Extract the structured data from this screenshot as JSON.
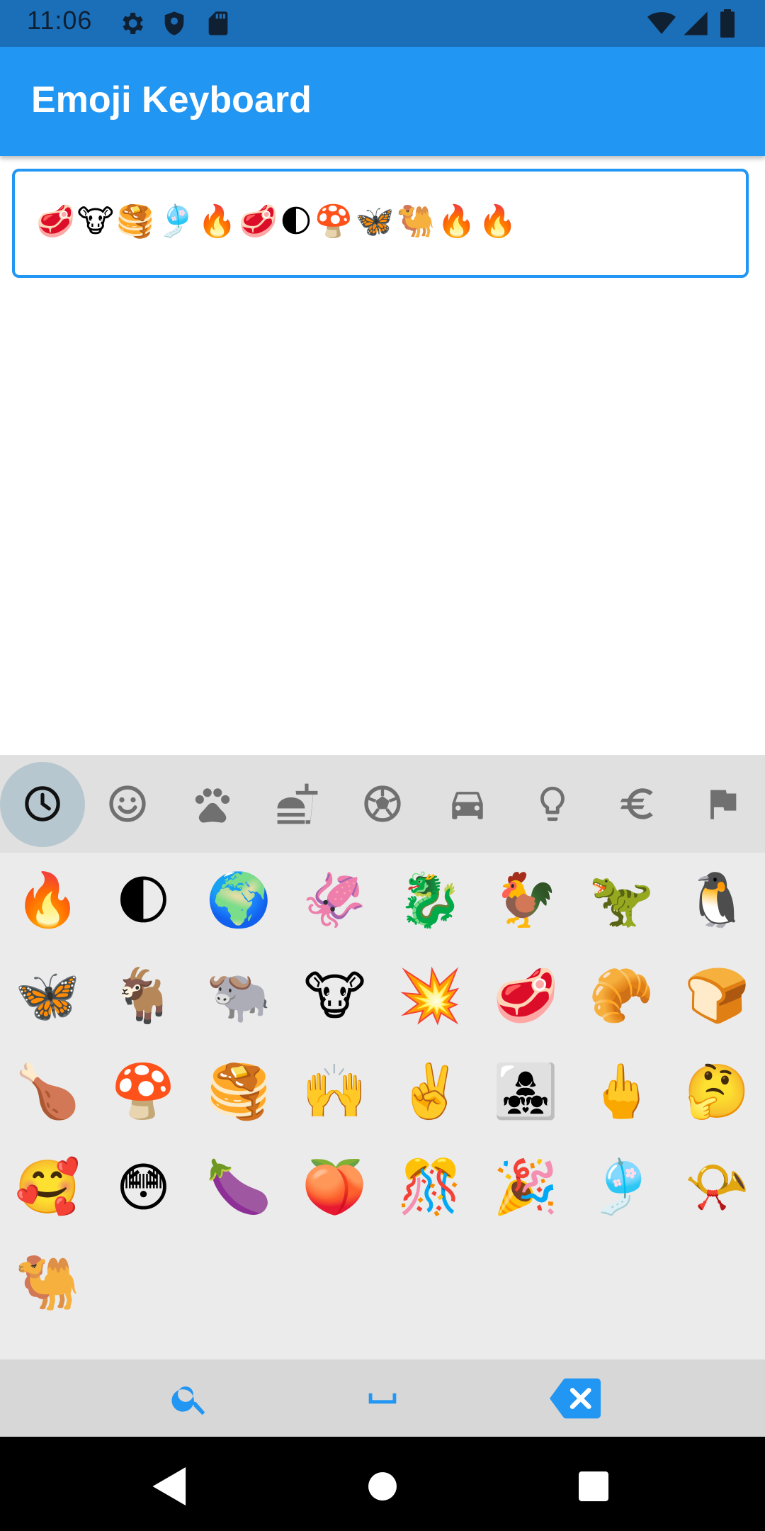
{
  "status_bar": {
    "time": "11:06",
    "icons": [
      "settings-icon",
      "shield-icon",
      "sd-card-icon",
      "wifi-icon",
      "signal-icon",
      "battery-icon"
    ]
  },
  "app_bar": {
    "title": "Emoji Keyboard",
    "color": "#2196f3"
  },
  "input": {
    "value": "🥩🐮🥞🎐🔥🥩🌓🍄🦋🐫🔥🔥"
  },
  "keyboard": {
    "active_category": "recent",
    "categories": [
      {
        "name": "recent",
        "icon": "clock-icon"
      },
      {
        "name": "smileys",
        "icon": "smiley-icon"
      },
      {
        "name": "animals",
        "icon": "paw-icon"
      },
      {
        "name": "food",
        "icon": "food-drink-icon"
      },
      {
        "name": "activities",
        "icon": "soccer-ball-icon"
      },
      {
        "name": "travel",
        "icon": "car-icon"
      },
      {
        "name": "objects",
        "icon": "lightbulb-icon"
      },
      {
        "name": "symbols",
        "icon": "euro-icon"
      },
      {
        "name": "flags",
        "icon": "flag-icon"
      }
    ],
    "emojis": [
      "🔥",
      "🌓",
      "🌍",
      "🦑",
      "🐉",
      "🐓",
      "🦖",
      "🐧",
      "🦋",
      "🐐",
      "🐃",
      "🐮",
      "💥",
      "🥩",
      "🥐",
      "🍞",
      "🍗",
      "🍄",
      "🥞",
      "🙌",
      "✌️",
      "👩‍👧‍👧",
      "🖕",
      "🤔",
      "🥰",
      "😳",
      "🍆",
      "🍑",
      "🎊",
      "🎉",
      "🎐",
      "📯",
      "🐫"
    ],
    "bottom": {
      "search_icon": "search-icon",
      "space_icon": "space-icon",
      "backspace_icon": "backspace-icon"
    },
    "accent": "#2196f3"
  },
  "nav_bar": {
    "icons": [
      "back-icon",
      "home-icon",
      "recents-icon"
    ]
  }
}
